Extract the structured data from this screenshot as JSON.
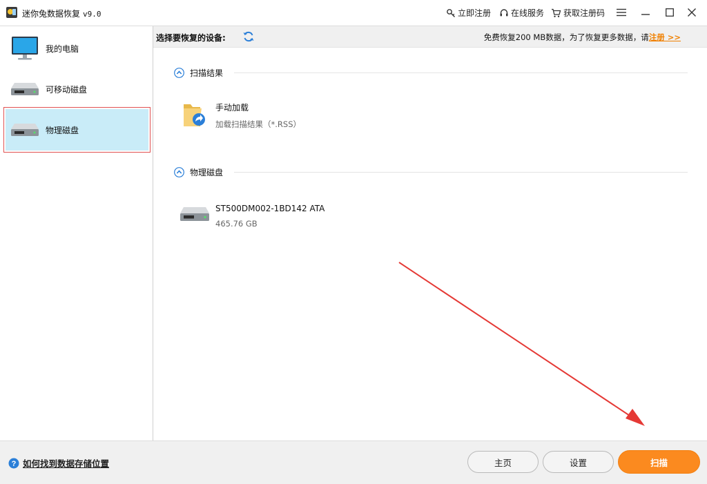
{
  "titlebar": {
    "app_name": "迷你兔数据恢复",
    "version": "v9.0",
    "links": {
      "register_now": "立即注册",
      "online_service": "在线服务",
      "get_code": "获取注册码"
    },
    "icons": [
      "key-icon",
      "headset-icon",
      "cart-icon",
      "menu-icon",
      "minimize-icon",
      "maximize-icon",
      "close-icon"
    ]
  },
  "sidebar": {
    "items": [
      {
        "label": "我的电脑",
        "icon": "monitor-icon"
      },
      {
        "label": "可移动磁盘",
        "icon": "drive-icon"
      },
      {
        "label": "物理磁盘",
        "icon": "drive-icon",
        "selected": true
      }
    ]
  },
  "device_header": {
    "label": "选择要恢复的设备:",
    "promo_text": "免费恢复200 MB数据，为了恢复更多数据，请",
    "register_link": "注册 >>"
  },
  "sections": [
    {
      "title": "扫描结果",
      "entry_name": "手动加载",
      "entry_sub": "加载扫描结果（*.RSS）"
    },
    {
      "title": "物理磁盘",
      "entry_name": "ST500DM002-1BD142 ATA",
      "entry_sub": "465.76 GB"
    }
  ],
  "footer": {
    "help_text": "如何找到数据存储位置",
    "home_button": "主页",
    "settings_button": "设置",
    "scan_button": "扫描"
  },
  "colors": {
    "accent_orange": "#fb8a1f",
    "selected_bg": "#c9ecf8",
    "selection_outline": "#e05050",
    "annotation_arrow": "#e53935",
    "link_blue": "#2b7fd8"
  }
}
